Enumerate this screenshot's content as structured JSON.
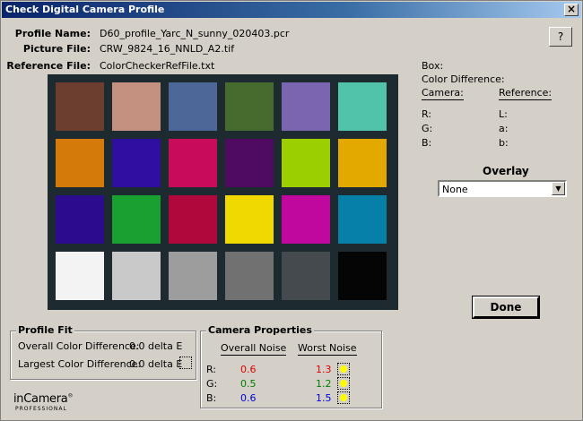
{
  "window": {
    "title": "Check Digital Camera Profile",
    "close_label": "×"
  },
  "profile_info": {
    "profile_name_label": "Profile Name:",
    "profile_name": "D60_profile_Yarc_N_sunny_020403.pcr",
    "picture_file_label": "Picture File:",
    "picture_file": "CRW_9824_16_NNLD_A2.tif",
    "reference_file_label": "Reference File:",
    "reference_file": "ColorCheckerRefFile.txt"
  },
  "help_label": "?",
  "checker": {
    "patches": [
      [
        "#6b3e2f",
        "#c49180",
        "#4d6898",
        "#466b2f",
        "#7a66b0",
        "#50c3aa"
      ],
      [
        "#d47a0b",
        "#300ea0",
        "#c80b5a",
        "#4e0b60",
        "#9bcf00",
        "#e3a900"
      ],
      [
        "#2d0b8f",
        "#18a030",
        "#b0073c",
        "#f0d900",
        "#c0089f",
        "#0780a8"
      ],
      [
        "#f3f3f3",
        "#c9c9c9",
        "#9d9d9d",
        "#717171",
        "#454a4e",
        "#050505"
      ]
    ]
  },
  "side_info": {
    "box_label": "Box:",
    "color_difference_label": "Color Difference:",
    "camera_header": "Camera:",
    "reference_header": "Reference:",
    "camera_rows": [
      "R:",
      "G:",
      "B:"
    ],
    "reference_rows": [
      "L:",
      "a:",
      "b:"
    ]
  },
  "overlay": {
    "title": "Overlay",
    "selected": "None",
    "arrow": "▼"
  },
  "done_label": "Done",
  "profile_fit": {
    "title": "Profile Fit",
    "overall_label": "Overall Color Difference:",
    "overall_value": "0.0 delta E",
    "largest_label": "Largest Color Difference:",
    "largest_value": "0.0 delta E"
  },
  "camera_properties": {
    "title": "Camera Properties",
    "overall_header": "Overall Noise",
    "worst_header": "Worst Noise",
    "rows": [
      {
        "channel": "R:",
        "overall": "0.6",
        "worst": "1.3",
        "color": "#e00000"
      },
      {
        "channel": "G:",
        "overall": "0.5",
        "worst": "1.2",
        "color": "#008000"
      },
      {
        "channel": "B:",
        "overall": "0.6",
        "worst": "1.5",
        "color": "#0000e0"
      }
    ]
  },
  "logo": {
    "brand": "inCamera",
    "mark": "®",
    "sub": "PROFESSIONAL"
  }
}
